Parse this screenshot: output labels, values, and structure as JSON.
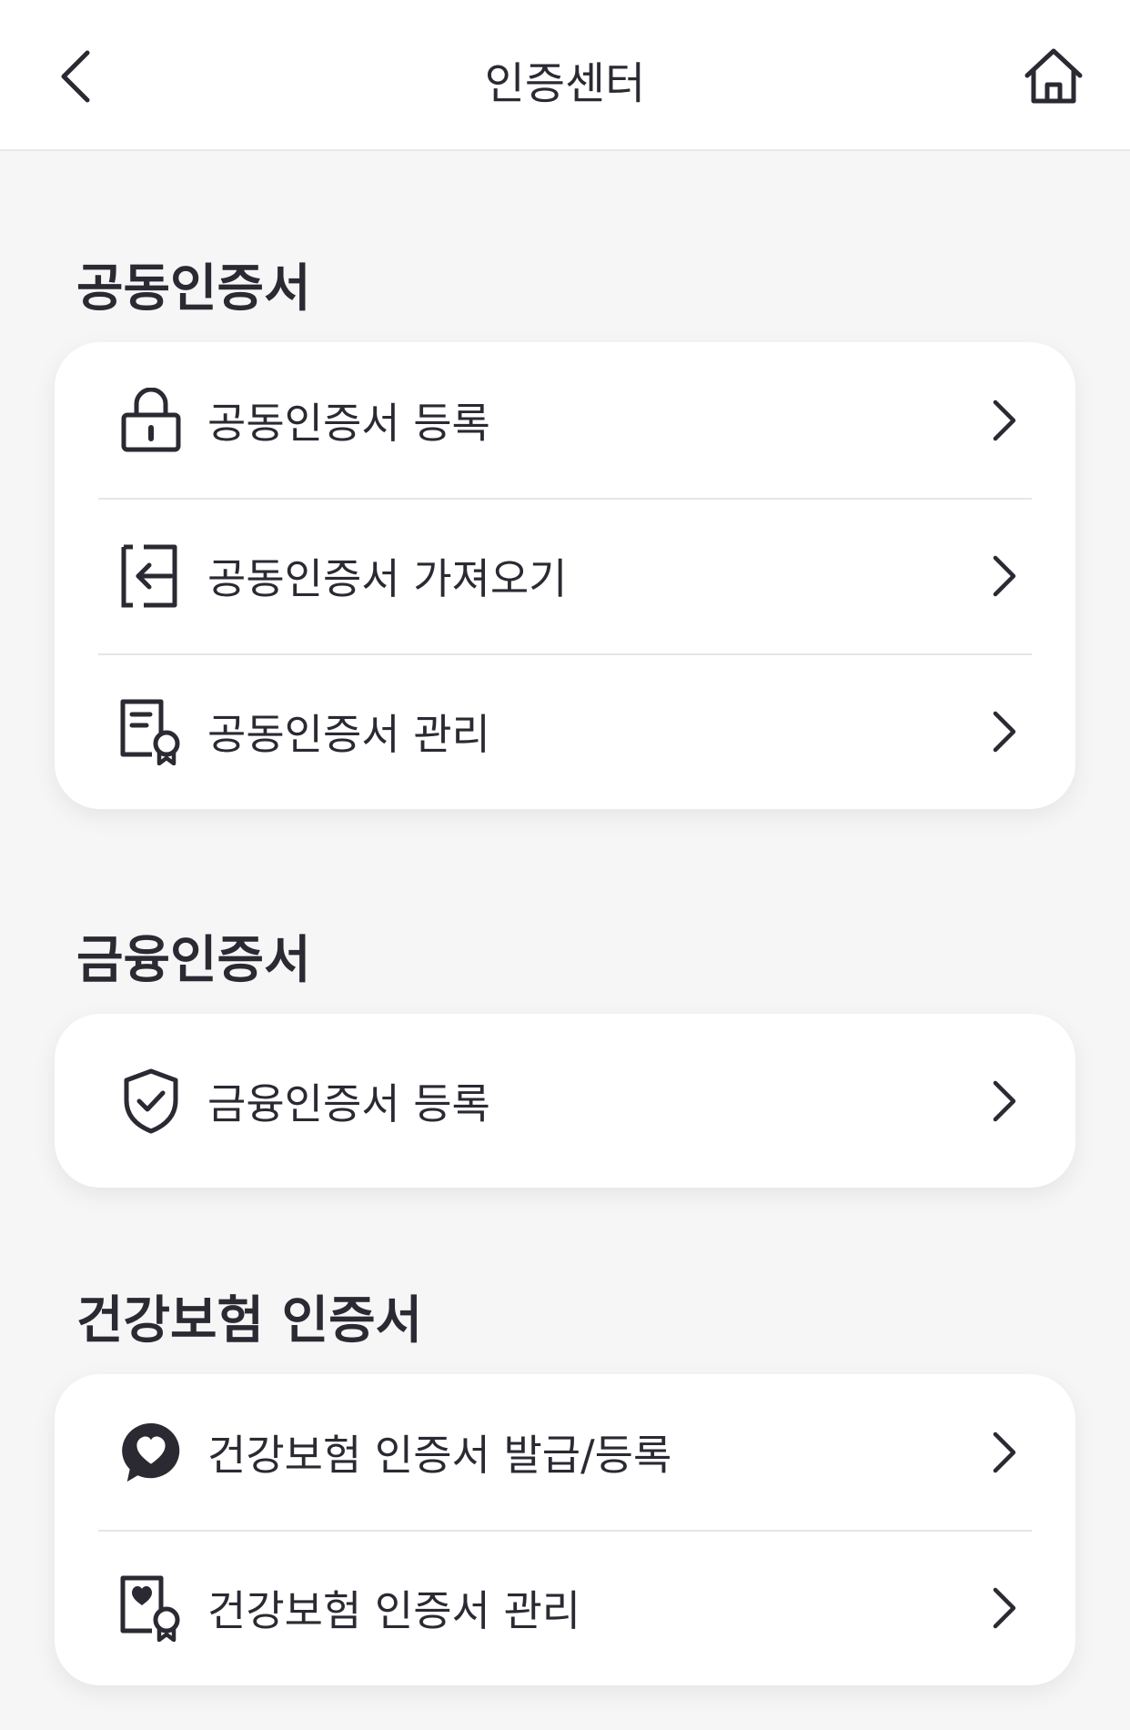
{
  "header": {
    "title": "인증센터",
    "back_icon": "chevron-left-icon",
    "home_icon": "home-icon"
  },
  "sections": [
    {
      "title": "공동인증서",
      "items": [
        {
          "label": "공동인증서 등록",
          "icon": "lock-icon"
        },
        {
          "label": "공동인증서 가져오기",
          "icon": "import-icon"
        },
        {
          "label": "공동인증서 관리",
          "icon": "certificate-icon"
        }
      ]
    },
    {
      "title": "금융인증서",
      "items": [
        {
          "label": "금융인증서 등록",
          "icon": "shield-check-icon"
        }
      ]
    },
    {
      "title": "건강보험 인증서",
      "items": [
        {
          "label": "건강보험 인증서 발급/등록",
          "icon": "heart-bubble-icon"
        },
        {
          "label": "건강보험 인증서 관리",
          "icon": "heart-certificate-icon"
        }
      ]
    }
  ],
  "colors": {
    "background": "#f6f6f7",
    "card": "#ffffff",
    "text": "#2b2a33",
    "divider": "#e6e6e9"
  }
}
